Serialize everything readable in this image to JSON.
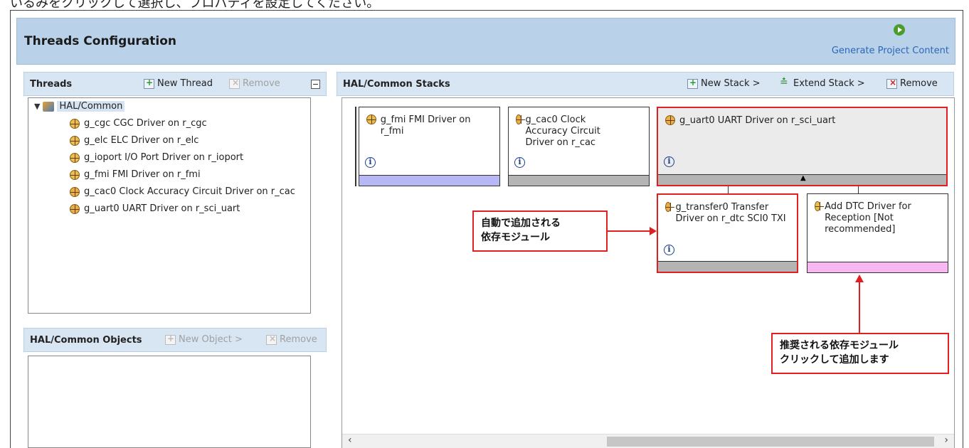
{
  "top_text": "いるみをクリックして選択し、プロパティを設定してください。",
  "editor": {
    "title": "Threads Configuration",
    "generate_label": "Generate Project Content"
  },
  "threads_panel": {
    "title": "Threads",
    "new_thread": "New Thread",
    "remove": "Remove",
    "root": "HAL/Common",
    "items": [
      "g_cgc CGC Driver on r_cgc",
      "g_elc ELC Driver on r_elc",
      "g_ioport I/O Port Driver on r_ioport",
      "g_fmi FMI Driver on r_fmi",
      "g_cac0 Clock Accuracy Circuit Driver on r_cac",
      "g_uart0 UART Driver on r_sci_uart"
    ]
  },
  "objects_panel": {
    "title": "HAL/Common Objects",
    "new_object": "New Object >",
    "remove": "Remove"
  },
  "stacks_panel": {
    "title": "HAL/Common Stacks",
    "new_stack": "New Stack >",
    "extend_stack": "Extend Stack >",
    "remove": "Remove",
    "modules": {
      "fmi": "g_fmi FMI Driver on r_fmi",
      "cac0": "g_cac0 Clock Accuracy Circuit Driver on r_cac",
      "uart0": "g_uart0 UART Driver on r_sci_uart",
      "transfer0": "g_transfer0 Transfer Driver on r_dtc SCI0 TXI",
      "add_dtc": "Add DTC Driver for Reception [Not recommended]"
    },
    "info_glyph": "i"
  },
  "callouts": {
    "auto_added_line1": "自動で追加される",
    "auto_added_line2": "依存モジュール",
    "recommended_line1": "推奨される依存モジュール",
    "recommended_line2": "クリックして追加します"
  },
  "colors": {
    "header_bg": "#b9d2ea",
    "accent_red": "#e02020",
    "fmi_bar": "#b7b7f5",
    "gray_bar": "#b4b4b4",
    "pink_bar": "#f7b8f2",
    "link_blue": "#2a68b8"
  }
}
